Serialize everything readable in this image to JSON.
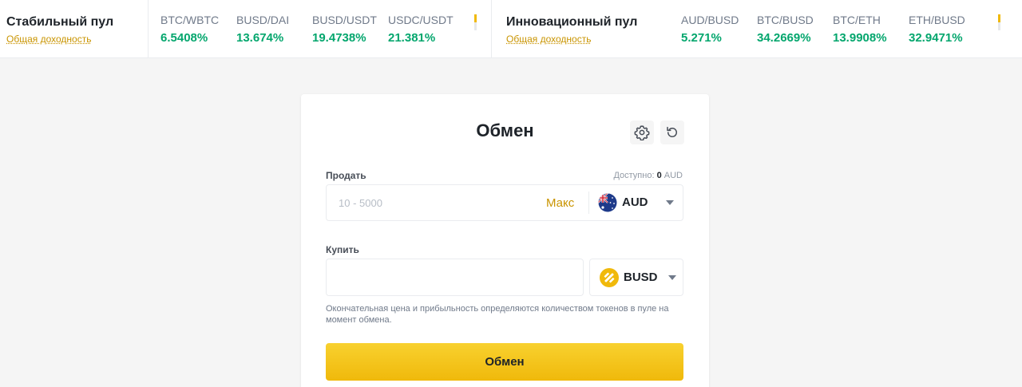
{
  "stable_pool": {
    "title": "Стабильный пул",
    "subtitle": "Общая доходность",
    "pairs": [
      {
        "name": "BTC/WBTC",
        "value": "6.5408%"
      },
      {
        "name": "BUSD/DAI",
        "value": "13.674%"
      },
      {
        "name": "BUSD/USDT",
        "value": "19.4738%"
      },
      {
        "name": "USDC/USDT",
        "value": "21.381%"
      }
    ]
  },
  "innovation_pool": {
    "title": "Инновационный пул",
    "subtitle": "Общая доходность",
    "pairs": [
      {
        "name": "AUD/BUSD",
        "value": "5.271%"
      },
      {
        "name": "BTC/BUSD",
        "value": "34.2669%"
      },
      {
        "name": "BTC/ETH",
        "value": "13.9908%"
      },
      {
        "name": "ETH/BUSD",
        "value": "32.9471%"
      }
    ]
  },
  "swap": {
    "title": "Обмен",
    "sell_label": "Продать",
    "available_label": "Доступно:",
    "available_amount": "0",
    "available_currency": "AUD",
    "sell_placeholder": "10 - 5000",
    "max_label": "Макс",
    "sell_currency": "AUD",
    "buy_label": "Купить",
    "buy_value": "",
    "buy_currency": "BUSD",
    "hint": "Окончательная цена и прибыльность определяются количеством токенов в пуле на момент обмена.",
    "button_label": "Обмен"
  },
  "colors": {
    "positive": "#03a66d",
    "accent": "#f0b90b",
    "link": "#c99400"
  },
  "icons": [
    "settings-gear-icon",
    "refresh-icon",
    "aud-flag-icon",
    "busd-coin-icon",
    "chevron-down-icon"
  ]
}
